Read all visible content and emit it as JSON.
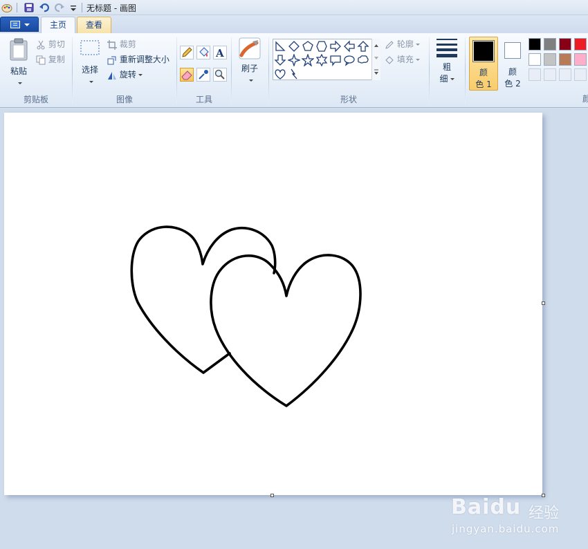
{
  "window": {
    "title": "无标题 - 画图"
  },
  "tabs": [
    {
      "label": "主页"
    },
    {
      "label": "查看"
    }
  ],
  "ribbon": {
    "clipboard": {
      "paste": "粘贴",
      "cut": "剪切",
      "copy": "复制",
      "group": "剪贴板"
    },
    "image": {
      "select": "选择",
      "crop": "裁剪",
      "resize": "重新调整大小",
      "rotate": "旋转",
      "group": "图像"
    },
    "tools": {
      "group": "工具"
    },
    "brushes": {
      "label": "刷子"
    },
    "shapes": {
      "outline": "轮廓",
      "fill": "填充",
      "group": "形状"
    },
    "size": {
      "line1": "粗",
      "line2": "细"
    },
    "color1": {
      "line1": "颜",
      "line2": "色 1",
      "value": "#000000"
    },
    "color2": {
      "line1": "颜",
      "line2": "色 2",
      "value": "#ffffff"
    },
    "colors_group_fragment": "颜"
  },
  "palette": [
    [
      "#000000",
      "#7f7f7f",
      "#880015",
      "#ed1c24"
    ],
    [
      "#ffffff",
      "#c3c3c3",
      "#b97a57",
      "#ffaec9"
    ]
  ],
  "watermark": {
    "logo": "Baidu",
    "cn": "经验",
    "url": "jingyan.baidu.com"
  }
}
